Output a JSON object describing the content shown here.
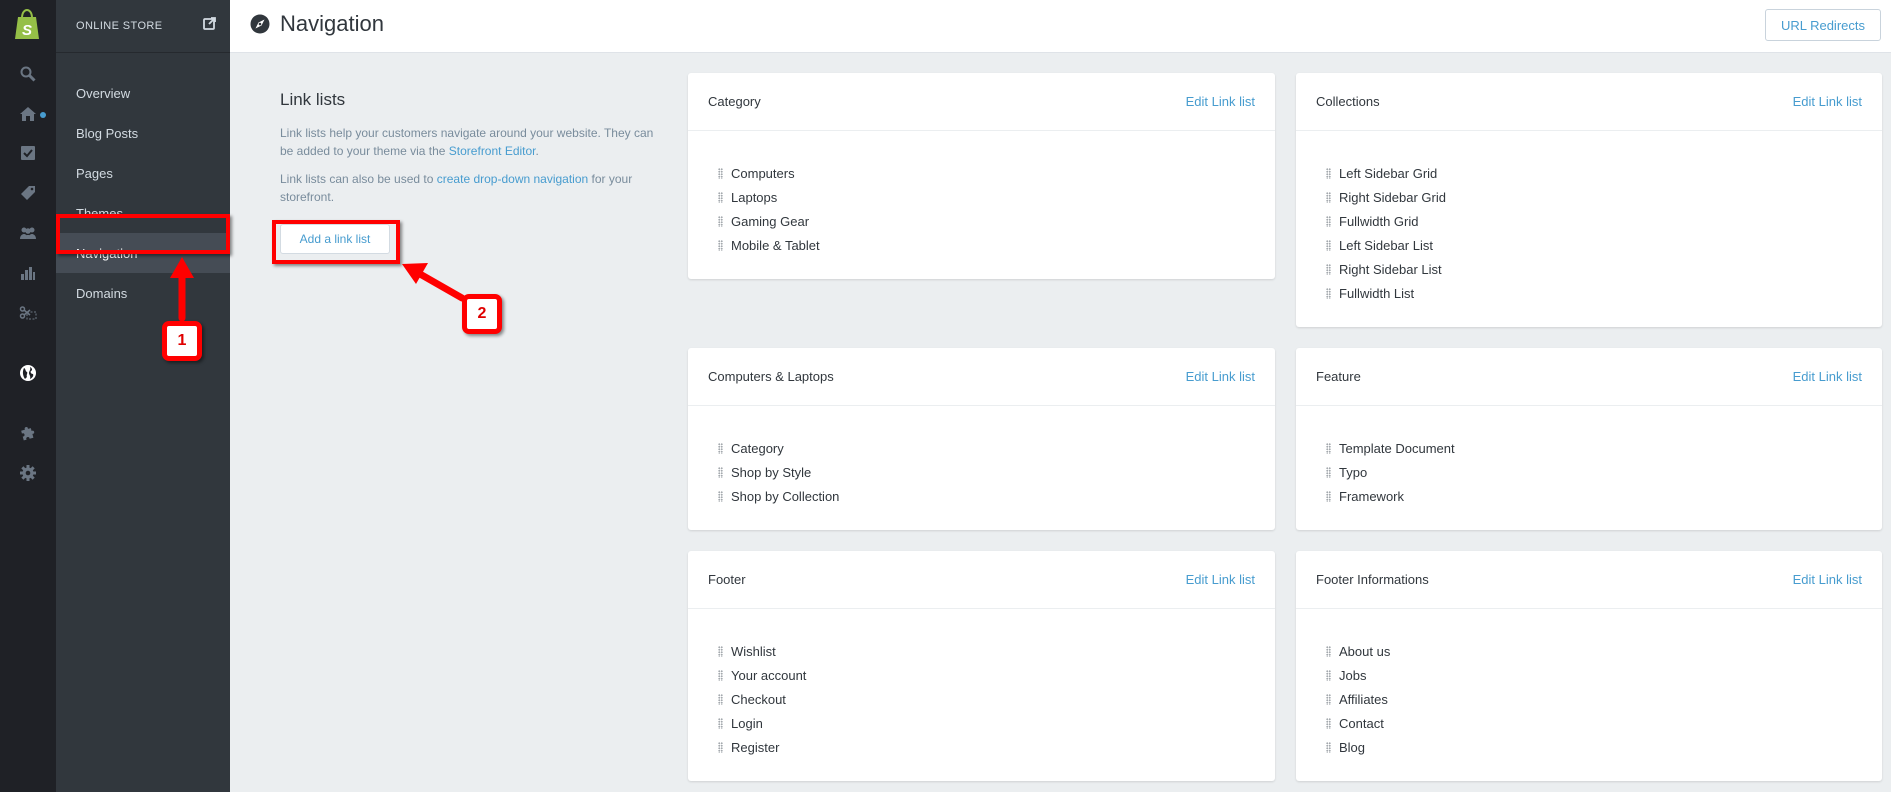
{
  "rail": {
    "icons": [
      "shopify-logo-icon",
      "search-icon",
      "home-icon",
      "orders-icon",
      "products-tag-icon",
      "customers-icon",
      "reports-icon",
      "discounts-icon",
      "online-store-globe-icon",
      "apps-puzzle-icon",
      "settings-gear-icon"
    ],
    "accent": "#479ccf",
    "logo_color": "#95bf47"
  },
  "subnav": {
    "title": "ONLINE STORE",
    "items": [
      {
        "label": "Overview",
        "active": false
      },
      {
        "label": "Blog Posts",
        "active": false
      },
      {
        "label": "Pages",
        "active": false
      },
      {
        "label": "Themes",
        "active": false
      },
      {
        "label": "Navigation",
        "active": true
      },
      {
        "label": "Domains",
        "active": false
      }
    ]
  },
  "header": {
    "title": "Navigation",
    "icon": "compass-icon",
    "url_redirects_label": "URL Redirects"
  },
  "intro": {
    "heading": "Link lists",
    "p1_text": "Link lists help your customers navigate around your website. They can be added to your theme via the",
    "p1_link": "Storefront Editor",
    "p1_end": ".",
    "p2_text": "Link lists can also be used to",
    "p2_link": "create drop-down navigation",
    "p2_end": "for your storefront.",
    "add_button_label": "Add a link list"
  },
  "link_lists": [
    {
      "title": "Category",
      "edit_label": "Edit Link list",
      "links": [
        "Computers",
        "Laptops",
        "Gaming Gear",
        "Mobile & Tablet"
      ]
    },
    {
      "title": "Collections",
      "edit_label": "Edit Link list",
      "links": [
        "Left Sidebar Grid",
        "Right Sidebar Grid",
        "Fullwidth Grid",
        "Left Sidebar List",
        "Right Sidebar List",
        "Fullwidth List"
      ]
    },
    {
      "title": "Computers & Laptops",
      "edit_label": "Edit Link list",
      "links": [
        "Category",
        "Shop by Style",
        "Shop by Collection"
      ]
    },
    {
      "title": "Feature",
      "edit_label": "Edit Link list",
      "links": [
        "Template Document",
        "Typo",
        "Framework"
      ]
    },
    {
      "title": "Footer",
      "edit_label": "Edit Link list",
      "links": [
        "Wishlist",
        "Your account",
        "Checkout",
        "Login",
        "Register"
      ]
    },
    {
      "title": "Footer Informations",
      "edit_label": "Edit Link list",
      "links": [
        "About us",
        "Jobs",
        "Affiliates",
        "Contact",
        "Blog"
      ]
    }
  ],
  "annotations": [
    {
      "label": "1",
      "target": "Navigation"
    },
    {
      "label": "2",
      "target": "Add a link list"
    }
  ]
}
